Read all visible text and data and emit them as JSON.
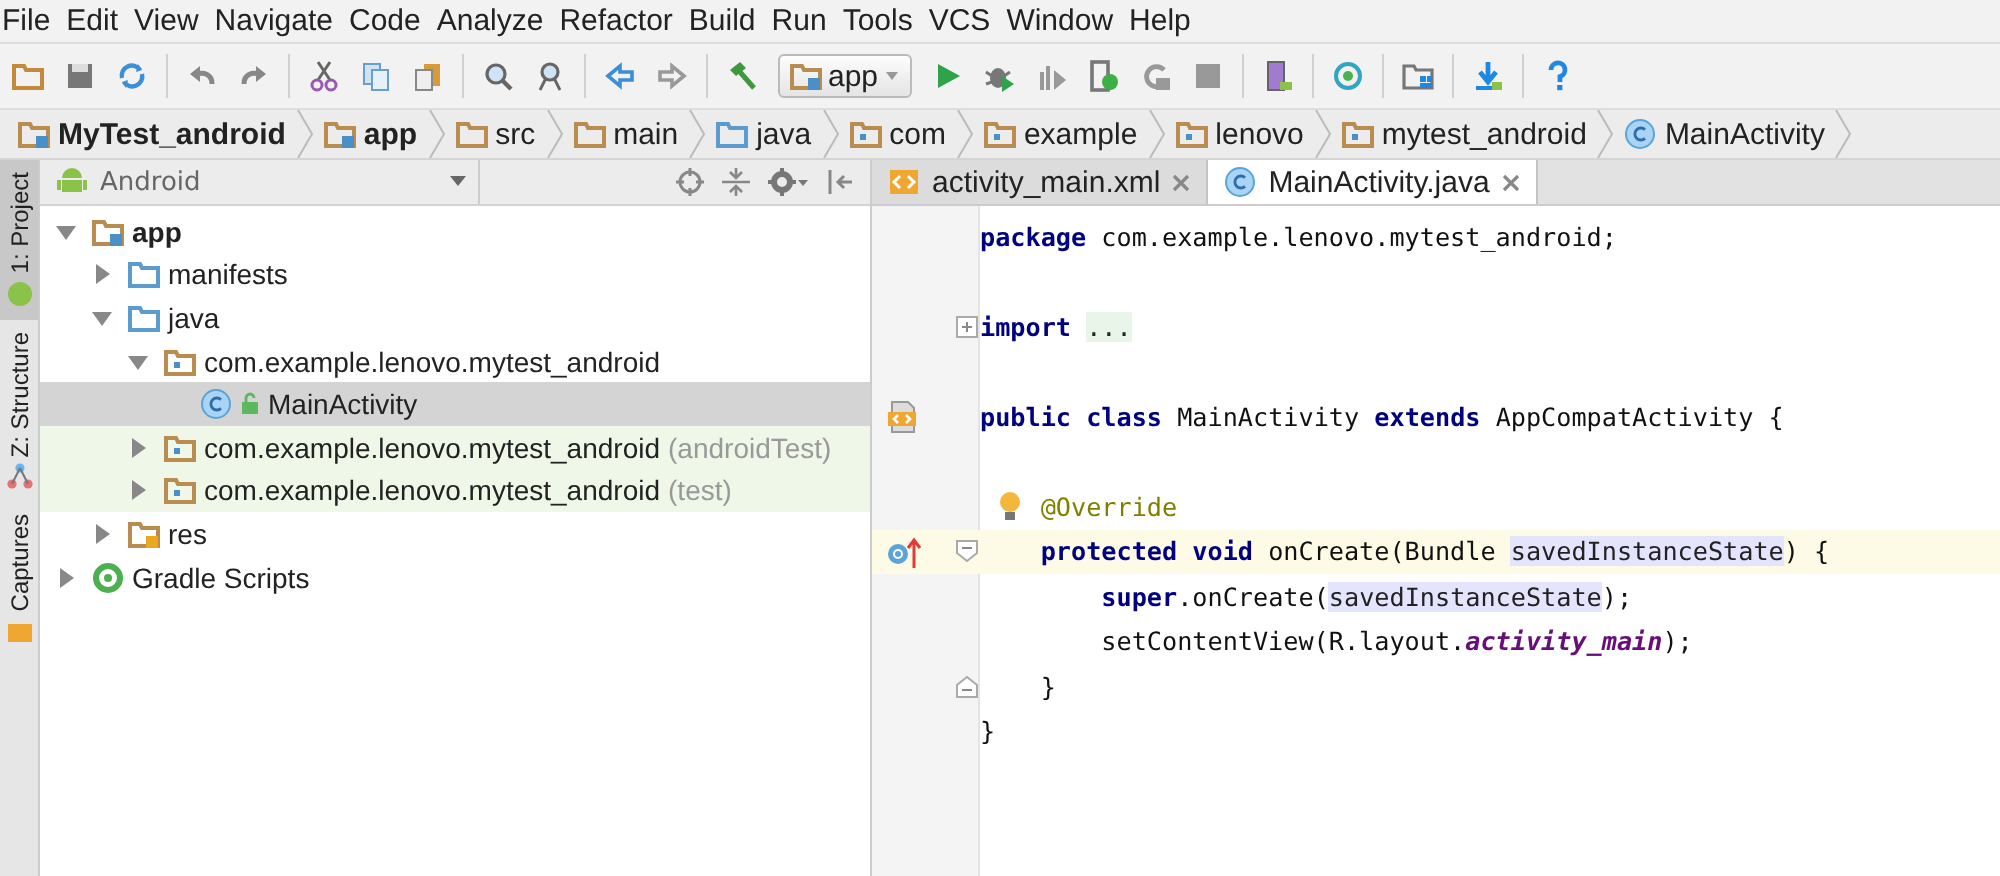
{
  "menu": [
    "File",
    "Edit",
    "View",
    "Navigate",
    "Code",
    "Analyze",
    "Refactor",
    "Build",
    "Run",
    "Tools",
    "VCS",
    "Window",
    "Help"
  ],
  "toolbar": {
    "run_config": "app"
  },
  "breadcrumbs": [
    {
      "label": "MyTest_android",
      "bold": true,
      "kind": "module"
    },
    {
      "label": "app",
      "bold": true,
      "kind": "module"
    },
    {
      "label": "src",
      "bold": false,
      "kind": "folder"
    },
    {
      "label": "main",
      "bold": false,
      "kind": "folder"
    },
    {
      "label": "java",
      "bold": false,
      "kind": "source"
    },
    {
      "label": "com",
      "bold": false,
      "kind": "package"
    },
    {
      "label": "example",
      "bold": false,
      "kind": "package"
    },
    {
      "label": "lenovo",
      "bold": false,
      "kind": "package"
    },
    {
      "label": "mytest_android",
      "bold": false,
      "kind": "package"
    },
    {
      "label": "MainActivity",
      "bold": false,
      "kind": "class"
    }
  ],
  "side_tabs": [
    {
      "label": "1: Project",
      "selected": true
    },
    {
      "label": "Z: Structure",
      "selected": false
    },
    {
      "label": "Captures",
      "selected": false
    }
  ],
  "project_panel": {
    "view": "Android",
    "tree": [
      {
        "label": "app",
        "kind": "module",
        "bold": true,
        "expanded": true,
        "children": [
          {
            "label": "manifests",
            "kind": "source",
            "expanded": false
          },
          {
            "label": "java",
            "kind": "source",
            "expanded": true,
            "children": [
              {
                "label": "com.example.lenovo.mytest_android",
                "kind": "package",
                "expanded": true,
                "children": [
                  {
                    "label": "MainActivity",
                    "kind": "class",
                    "selected": true
                  }
                ]
              },
              {
                "label": "com.example.lenovo.mytest_android",
                "suffix": "(androidTest)",
                "kind": "package",
                "tinted": true,
                "expanded": false
              },
              {
                "label": "com.example.lenovo.mytest_android",
                "suffix": "(test)",
                "kind": "package",
                "tinted": true,
                "expanded": false
              }
            ]
          },
          {
            "label": "res",
            "kind": "res",
            "expanded": false
          }
        ]
      },
      {
        "label": "Gradle Scripts",
        "kind": "gradle",
        "expanded": false
      }
    ]
  },
  "editor_tabs": [
    {
      "label": "activity_main.xml",
      "kind": "xml",
      "selected": false
    },
    {
      "label": "MainActivity.java",
      "kind": "class",
      "selected": true
    }
  ],
  "code_lines": [
    {
      "kind": "code",
      "tokens": [
        {
          "kind": "keyword",
          "text": "package"
        },
        {
          "kind": "plain",
          "text": "com.example.lenovo.mytest_android;"
        }
      ]
    },
    {
      "kind": "blank"
    },
    {
      "kind": "code",
      "fold": {
        "kind": "collapsed"
      },
      "tokens": [
        {
          "kind": "keyword",
          "text": "import"
        },
        {
          "kind": "folded",
          "text": "..."
        }
      ]
    },
    {
      "kind": "blank"
    },
    {
      "kind": "code",
      "marker": {
        "kind": "layout"
      },
      "tokens": [
        {
          "kind": "keyword",
          "text": "public class"
        },
        {
          "kind": "plain",
          "text": "MainActivity"
        },
        {
          "kind": "keyword",
          "text": "extends"
        },
        {
          "kind": "plain",
          "text": "AppCompatActivity {"
        }
      ],
      "children": [
        {
          "kind": "blank"
        },
        {
          "kind": "code",
          "marker": {
            "kind": "bulb"
          },
          "tokens": [
            {
              "kind": "annotation",
              "text": "@Override"
            }
          ]
        },
        {
          "kind": "code",
          "marker": {
            "kind": "override"
          },
          "fold": {
            "kind": "open"
          },
          "current": true,
          "tokens": [
            {
              "kind": "keyword",
              "text": "protected void"
            },
            {
              "kind": "plain",
              "text": "onCreate(Bundle"
            },
            {
              "kind": "usage",
              "text": "savedInstanceState"
            },
            {
              "kind": "tight",
              "text": ") {"
            }
          ],
          "children": [
            {
              "kind": "code",
              "tokens": [
                {
                  "kind": "keyword",
                  "text": "super"
                },
                {
                  "kind": "tight",
                  "text": ".onCreate("
                },
                {
                  "kind": "usage-tight",
                  "text": "savedInstanceState"
                },
                {
                  "kind": "tight",
                  "text": ");"
                }
              ]
            },
            {
              "kind": "code",
              "tokens": [
                {
                  "kind": "plain",
                  "text": "setContentView(R.layout."
                },
                {
                  "kind": "field-tight",
                  "text": "activity_main"
                },
                {
                  "kind": "tight",
                  "text": ");"
                }
              ]
            }
          ]
        },
        {
          "kind": "code",
          "fold": {
            "kind": "end"
          },
          "tokens": [
            {
              "kind": "plain",
              "text": "}"
            }
          ]
        }
      ]
    },
    {
      "kind": "code",
      "tokens": [
        {
          "kind": "plain",
          "text": "}"
        }
      ]
    }
  ]
}
